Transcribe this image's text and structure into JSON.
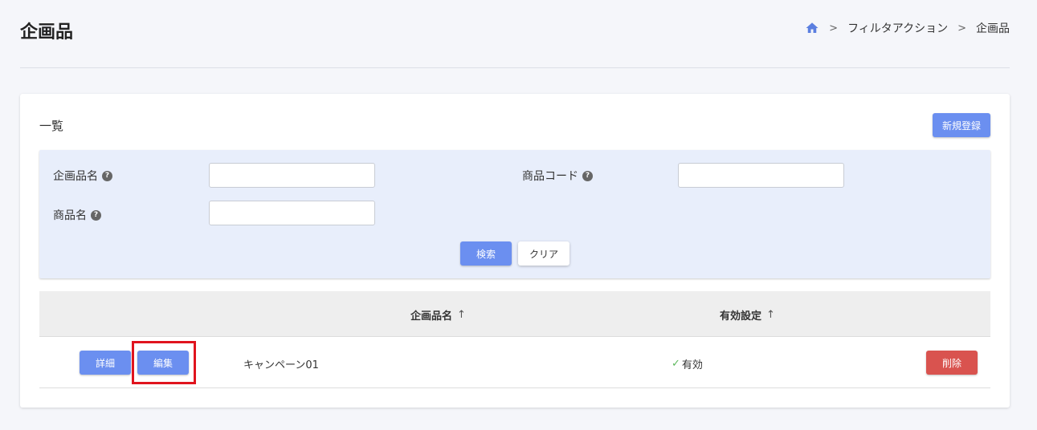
{
  "header": {
    "title": "企画品",
    "breadcrumb": {
      "home_icon": "home-icon",
      "items": [
        "フィルタアクション",
        "企画品"
      ]
    }
  },
  "card": {
    "title": "一覧",
    "new_button": "新規登録"
  },
  "search": {
    "fields": [
      {
        "label": "企画品名",
        "value": "",
        "placeholder": ""
      },
      {
        "label": "商品コード",
        "value": "",
        "placeholder": ""
      },
      {
        "label": "商品名",
        "value": "",
        "placeholder": ""
      }
    ],
    "search_button": "検索",
    "clear_button": "クリア"
  },
  "table": {
    "columns": [
      "企画品名",
      "有効設定"
    ],
    "sort_icon": "↑",
    "rows": [
      {
        "detail_button": "詳細",
        "edit_button": "編集",
        "name": "キャンペーン01",
        "status": "有効",
        "delete_button": "削除"
      }
    ]
  },
  "colors": {
    "primary": "#6b8ff0",
    "danger": "#d9534f",
    "highlight": "#e0141e",
    "panel": "#e8eefb"
  }
}
